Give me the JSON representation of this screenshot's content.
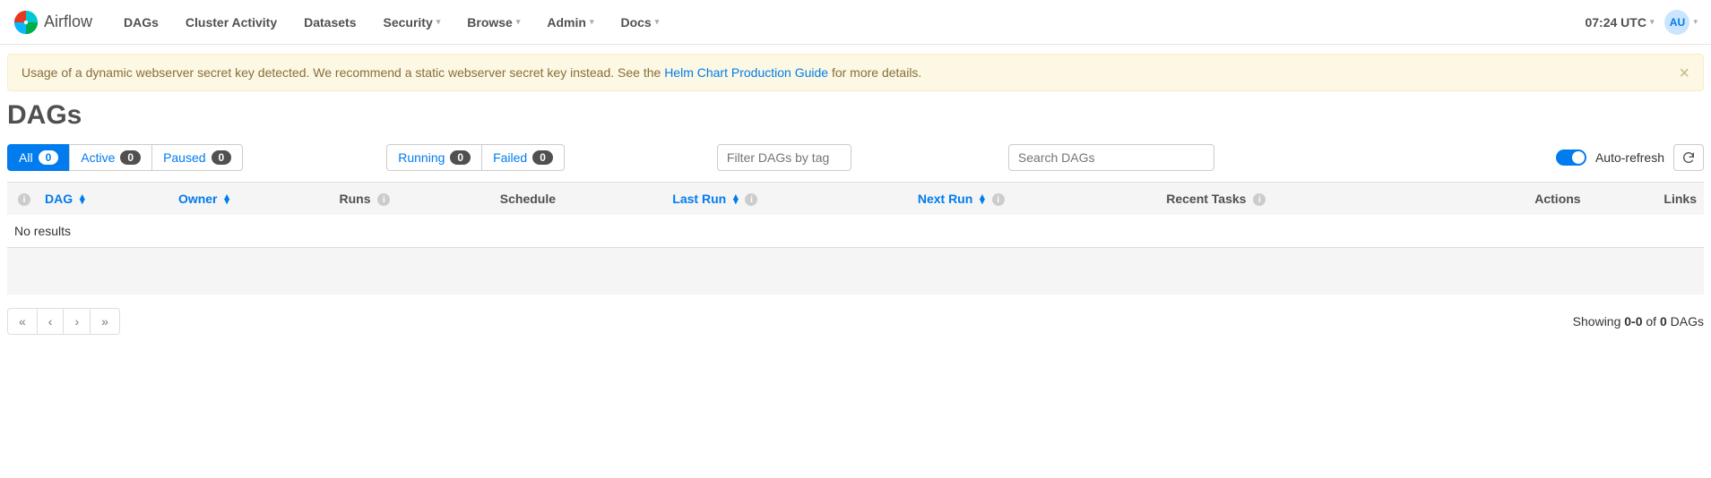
{
  "navbar": {
    "brand": "Airflow",
    "items": [
      {
        "label": "DAGs",
        "dropdown": false
      },
      {
        "label": "Cluster Activity",
        "dropdown": false
      },
      {
        "label": "Datasets",
        "dropdown": false
      },
      {
        "label": "Security",
        "dropdown": true
      },
      {
        "label": "Browse",
        "dropdown": true
      },
      {
        "label": "Admin",
        "dropdown": true
      },
      {
        "label": "Docs",
        "dropdown": true
      }
    ],
    "time": "07:24 UTC",
    "user_initials": "AU"
  },
  "alert": {
    "text_before": "Usage of a dynamic webserver secret key detected. We recommend a static webserver secret key instead. See the ",
    "link_text": "Helm Chart Production Guide",
    "text_after": " for more details."
  },
  "page_title": "DAGs",
  "status_filters": [
    {
      "label": "All",
      "count": "0",
      "active": true
    },
    {
      "label": "Active",
      "count": "0",
      "active": false
    },
    {
      "label": "Paused",
      "count": "0",
      "active": false
    }
  ],
  "run_filters": [
    {
      "label": "Running",
      "count": "0"
    },
    {
      "label": "Failed",
      "count": "0"
    }
  ],
  "tag_filter_placeholder": "Filter DAGs by tag",
  "search_placeholder": "Search DAGs",
  "auto_refresh_label": "Auto-refresh",
  "table": {
    "columns": {
      "dag": "DAG",
      "owner": "Owner",
      "runs": "Runs",
      "schedule": "Schedule",
      "last_run": "Last Run",
      "next_run": "Next Run",
      "recent_tasks": "Recent Tasks",
      "actions": "Actions",
      "links": "Links"
    },
    "empty_text": "No results"
  },
  "pagination": {
    "first": "«",
    "prev": "‹",
    "next": "›",
    "last": "»"
  },
  "count_text": {
    "prefix": "Showing ",
    "range": "0-0",
    "middle": " of ",
    "total": "0",
    "suffix": " DAGs"
  }
}
